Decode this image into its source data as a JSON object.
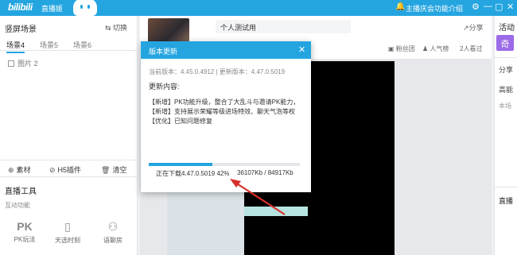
{
  "titlebar": {
    "logo": "bilibili",
    "logo_sub": "直播姬",
    "bell_icon": "bell-icon",
    "announcement": "主播庆会功能介绍",
    "controls": [
      "⚙",
      "—",
      "▢",
      "✕"
    ]
  },
  "left_panel": {
    "scene_title": "竖屏场景",
    "switch_label": "切换",
    "tabs": [
      "场景4",
      "场景5",
      "场景6"
    ],
    "active_tab": "场景4",
    "sources": [
      {
        "name": "图片 2"
      }
    ],
    "tools": {
      "material": "素材",
      "h5_plugin": "H5插件",
      "clear": "清空"
    },
    "live_tools_title": "直播工具",
    "interactive_title": "互动功能",
    "features": [
      {
        "icon": "PK",
        "label": "PK玩法"
      },
      {
        "icon": "▯",
        "label": "天选时刻"
      },
      {
        "icon": "⚇",
        "label": "语聊房"
      }
    ]
  },
  "room": {
    "title_value": "个人测试用",
    "share_label": "分享",
    "fans_group": "粉丝团",
    "popularity": "人气榜",
    "watched": "2人看过"
  },
  "right_panel": {
    "activity": "活动",
    "badge": "奇",
    "share_data": "分享",
    "high_energy": "高能",
    "this_scene": "本场",
    "live_room": "直播"
  },
  "dialog": {
    "title": "版本更新",
    "version_line": "当前版本：4.45.0.4912 | 更新版本：4.47.0.5019",
    "update_content_label": "更新内容:",
    "notes": [
      "【新增】PK功能升级，整合了大乱斗与邀请PK能力，",
      "【新增】支持展示荣耀等级进场特效、聊天气泡等权",
      "【优化】已知问题修复"
    ],
    "progress_fraction": 0.42,
    "progress_text": "正在下载4.47.0.5019  42%",
    "progress_size": "36107Kb / 84917Kb"
  },
  "colors": {
    "brand_blue": "#24a5e0",
    "annotation_red": "#d9302a"
  }
}
